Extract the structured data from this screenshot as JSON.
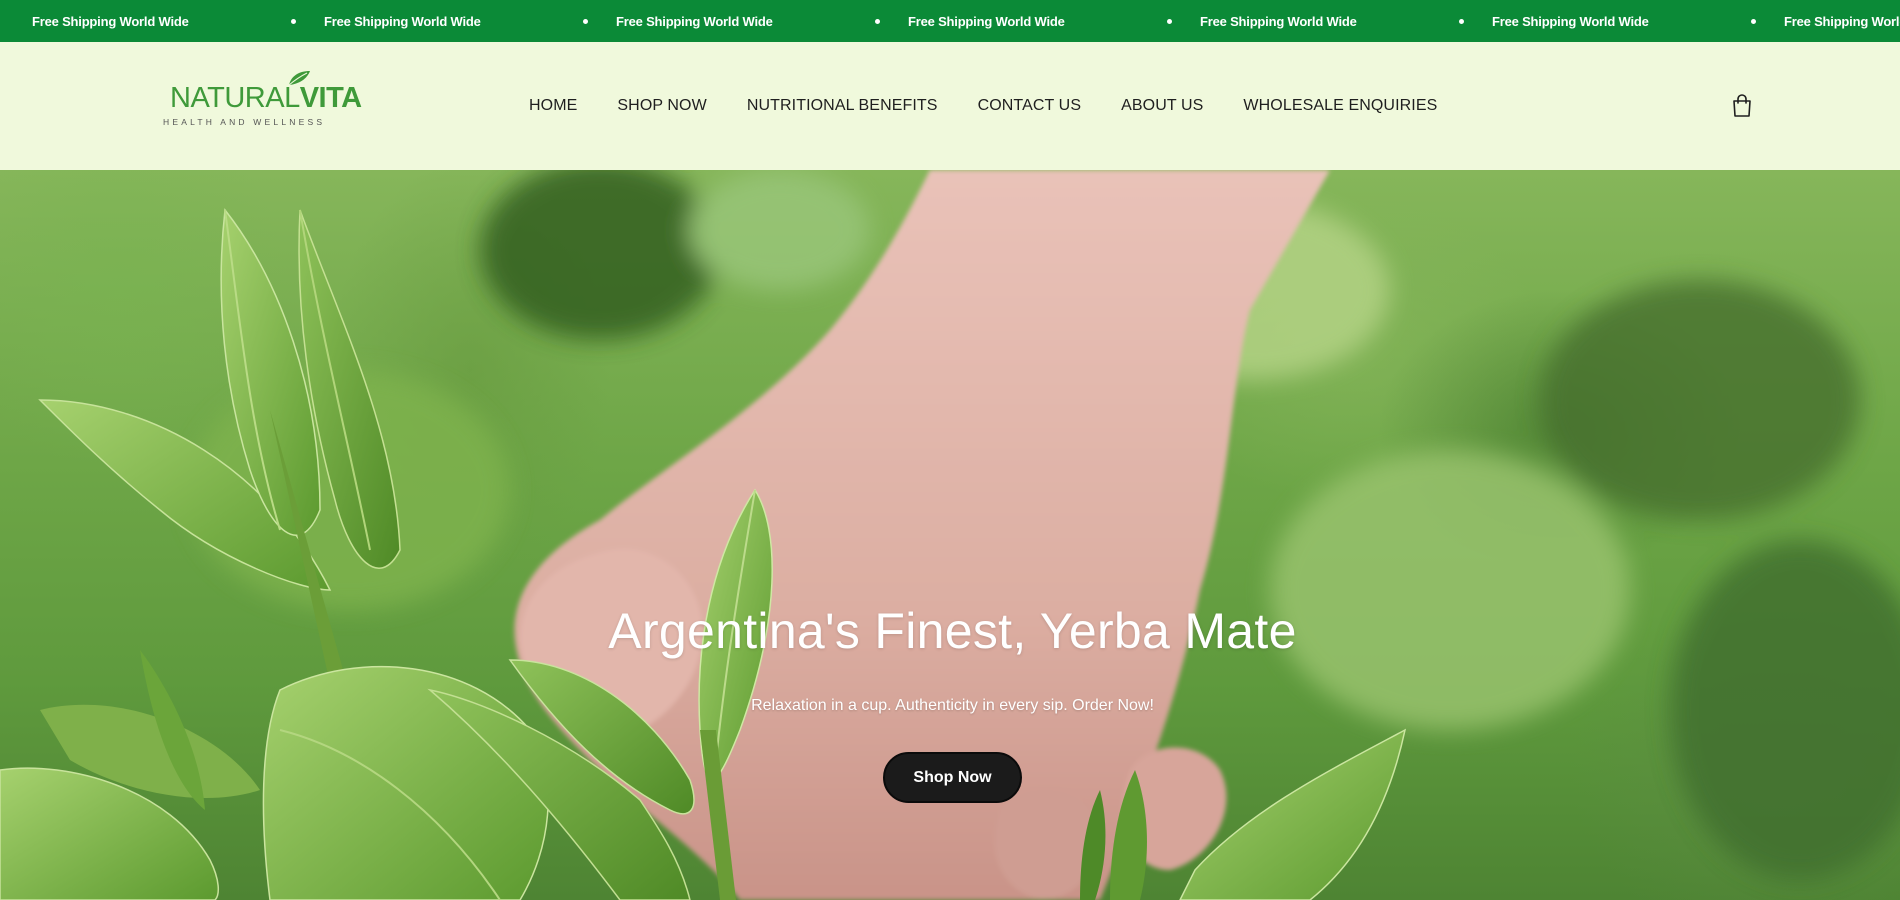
{
  "announcement": {
    "items": [
      "Free Shipping World Wide",
      "Free Shipping World Wide",
      "Free Shipping World Wide",
      "Free Shipping World Wide",
      "Free Shipping World Wide",
      "Free Shipping World Wide",
      "Free Shipping World Wide"
    ]
  },
  "logo": {
    "word_light": "NATURAL",
    "word_bold": "VITA",
    "tagline": "HEALTH AND WELLNESS"
  },
  "nav": {
    "items": [
      "HOME",
      "SHOP NOW",
      "NUTRITIONAL BENEFITS",
      "CONTACT US",
      "ABOUT US",
      "WHOLESALE ENQUIRIES"
    ]
  },
  "header": {
    "cart_icon": "shopping-bag-icon"
  },
  "hero": {
    "title": "Argentina's Finest, Yerba Mate",
    "subtitle": "Relaxation in a cup. Authenticity in every sip. Order Now!",
    "button_label": "Shop Now"
  },
  "colors": {
    "announcement_bg": "#0b8a37",
    "header_bg": "#f0f9dc",
    "logo_green": "#3f9a3a",
    "button_bg": "#1b1b1b"
  }
}
